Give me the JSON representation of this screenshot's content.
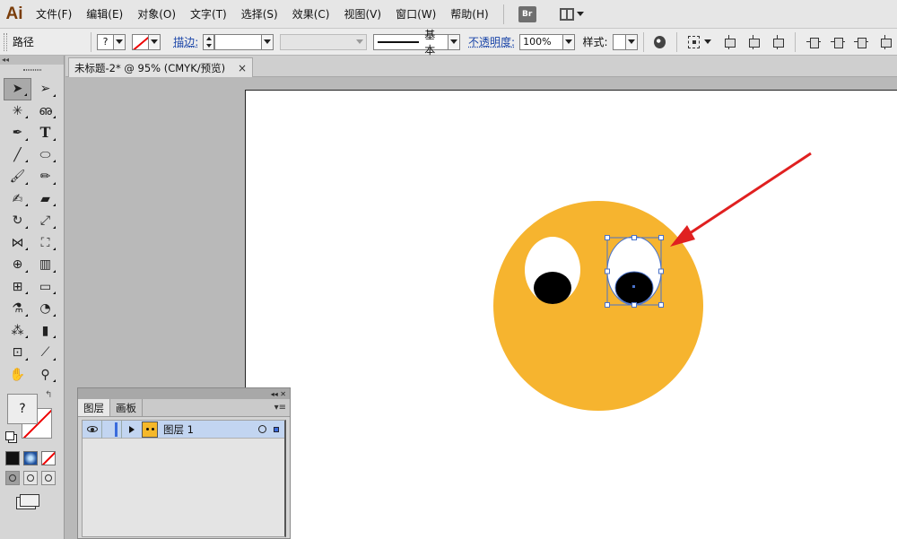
{
  "app": {
    "logo": "Ai"
  },
  "menu": [
    {
      "label": "文件(F)"
    },
    {
      "label": "编辑(E)"
    },
    {
      "label": "对象(O)"
    },
    {
      "label": "文字(T)"
    },
    {
      "label": "选择(S)"
    },
    {
      "label": "效果(C)"
    },
    {
      "label": "视图(V)"
    },
    {
      "label": "窗口(W)"
    },
    {
      "label": "帮助(H)"
    }
  ],
  "menubar_buttons": {
    "bridge_label": "Br"
  },
  "control": {
    "selection_type": "路径",
    "fill_value": "?",
    "stroke_label": "描边:",
    "stroke_weight": "",
    "variable_width": "",
    "stroke_profile": "基本",
    "opacity_label": "不透明度:",
    "opacity_value": "100%",
    "style_label": "样式:"
  },
  "document_tab": {
    "title": "未标题-2* @ 95% (CMYK/预览)",
    "close": "×"
  },
  "toolbox": {
    "collapse_glyph": "◂◂",
    "tools": [
      {
        "name": "selection-tool",
        "glyph": "➤",
        "active": true
      },
      {
        "name": "direct-selection-tool",
        "glyph": "➢"
      },
      {
        "name": "magic-wand-tool",
        "glyph": "✳"
      },
      {
        "name": "lasso-tool",
        "glyph": "ഌ"
      },
      {
        "name": "pen-tool",
        "glyph": "✒"
      },
      {
        "name": "type-tool",
        "glyph": "T",
        "serif": true
      },
      {
        "name": "line-segment-tool",
        "glyph": "╱"
      },
      {
        "name": "ellipse-tool",
        "glyph": "⬭"
      },
      {
        "name": "paintbrush-tool",
        "glyph": "🖌"
      },
      {
        "name": "pencil-tool",
        "glyph": "✏"
      },
      {
        "name": "blob-brush-tool",
        "glyph": "✍"
      },
      {
        "name": "eraser-tool",
        "glyph": "▰"
      },
      {
        "name": "rotate-tool",
        "glyph": "↻"
      },
      {
        "name": "scale-tool",
        "glyph": "⤢"
      },
      {
        "name": "width-tool",
        "glyph": "⋈"
      },
      {
        "name": "free-transform-tool",
        "glyph": "⛶"
      },
      {
        "name": "shape-builder-tool",
        "glyph": "⊕"
      },
      {
        "name": "perspective-grid-tool",
        "glyph": "▥"
      },
      {
        "name": "mesh-tool",
        "glyph": "⊞"
      },
      {
        "name": "gradient-tool",
        "glyph": "▭"
      },
      {
        "name": "eyedropper-tool",
        "glyph": "⚗"
      },
      {
        "name": "blend-tool",
        "glyph": "◔"
      },
      {
        "name": "symbol-sprayer-tool",
        "glyph": "⁂"
      },
      {
        "name": "column-graph-tool",
        "glyph": "▮"
      },
      {
        "name": "artboard-tool",
        "glyph": "⊡"
      },
      {
        "name": "slice-tool",
        "glyph": "⟋"
      },
      {
        "name": "hand-tool",
        "glyph": "✋"
      },
      {
        "name": "zoom-tool",
        "glyph": "⚲"
      }
    ],
    "fill_value": "?",
    "swap_glyph": "↰"
  },
  "layers_panel": {
    "title_glyphs": "◂◂  ✕",
    "tabs": [
      {
        "label": "图层",
        "active": true
      },
      {
        "label": "画板",
        "active": false
      }
    ],
    "menu_glyph": "▾≡",
    "layers": [
      {
        "name": "图层 1"
      }
    ]
  },
  "colors": {
    "face": "#F6B42F",
    "pupil": "#000000",
    "eye": "#FFFFFF",
    "selection": "#4A72C9",
    "arrow": "#E02020"
  }
}
